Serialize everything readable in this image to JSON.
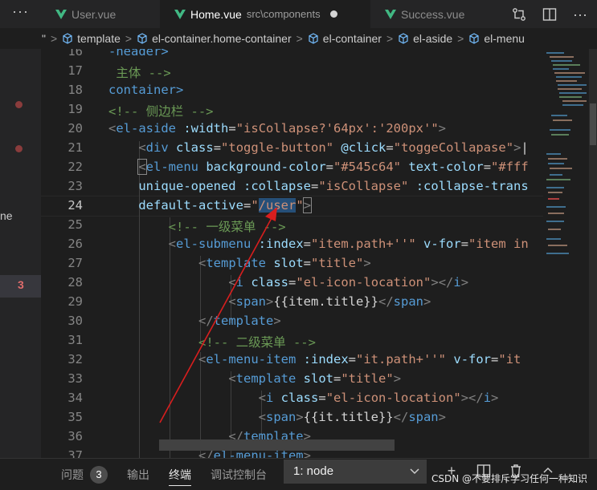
{
  "tabs": {
    "more_label": "···",
    "items": [
      {
        "label": "User.vue",
        "path": ""
      },
      {
        "label": "Home.vue",
        "path": "src\\components"
      },
      {
        "label": "Success.vue",
        "path": ""
      }
    ]
  },
  "breadcrumb": {
    "lead": "\"",
    "items": [
      "template",
      "el-container.home-container",
      "el-container",
      "el-aside",
      "el-menu"
    ]
  },
  "sidebar": {
    "partial_text": "ne",
    "problem_count": "3"
  },
  "editor": {
    "line_numbers": [
      "16",
      "17",
      "18",
      "19",
      "20",
      "21",
      "22",
      "23",
      "24",
      "25",
      "26",
      "27",
      "28",
      "29",
      "30",
      "31",
      "32",
      "33",
      "34",
      "35",
      "36",
      "37"
    ],
    "current_line": "24",
    "lines": {
      "l16": "-header>",
      "l17": " 主体 -->",
      "l18": "container>",
      "l19": "<!-- 侧边栏 -->",
      "l20_tag": "el-aside",
      "l20_attr": ":width",
      "l20_val": "isCollapse?'64px':'200px'",
      "l21_tag": "div",
      "l21_attr1": "class",
      "l21_val1": "toggle-button",
      "l21_attr2": "@click",
      "l21_val2": "toggeCollapase",
      "l22_tag": "el-menu",
      "l22_attr1": "background-color",
      "l22_val1": "#545c64",
      "l22_attr2": "text-color",
      "l22_val2": "#fff",
      "l23_attr1": "unique-opened",
      "l23_attr2": ":collapse",
      "l23_val2": "isCollapse",
      "l23_attr3": ":collapse-trans",
      "l24_attr": "default-active",
      "l24_val": "/user",
      "l25": "<!-- 一级菜单 -->",
      "l26_tag": "el-submenu",
      "l26_attr1": ":index",
      "l26_val1": "item.path+''",
      "l26_attr2": "v-for",
      "l26_val2": "item in",
      "l27_tag": "template",
      "l27_attr": "slot",
      "l27_val": "title",
      "l28_tag": "i",
      "l28_attr": "class",
      "l28_val": "el-icon-location",
      "l29_tag": "span",
      "l29_text": "{{item.title}}",
      "l30_tag": "template",
      "l31": "<!-- 二级菜单 -->",
      "l32_tag": "el-menu-item",
      "l32_attr1": ":index",
      "l32_val1": "it.path+''",
      "l32_attr2": "v-for",
      "l32_val2": "it",
      "l33_tag": "template",
      "l33_attr": "slot",
      "l33_val": "title",
      "l34_tag": "i",
      "l34_attr": "class",
      "l34_val": "el-icon-location",
      "l35_tag": "span",
      "l35_text": "{{it.title}}",
      "l36_tag": "template",
      "l37_tag": "el-menu-item"
    }
  },
  "panel": {
    "tabs": [
      {
        "label": "问题"
      },
      {
        "label": "输出"
      },
      {
        "label": "终端"
      },
      {
        "label": "调试控制台"
      }
    ],
    "problem_count": "3",
    "terminal_select": "1: node",
    "watermark": "CSDN @不要排斥学习任何一种知识"
  },
  "colors": {
    "vue_green": "#41b883",
    "tag": "#569cd6",
    "attribute": "#9cdcfe",
    "string": "#ce9178",
    "comment": "#6a9955",
    "annotation_arrow": "#d81e1e"
  }
}
